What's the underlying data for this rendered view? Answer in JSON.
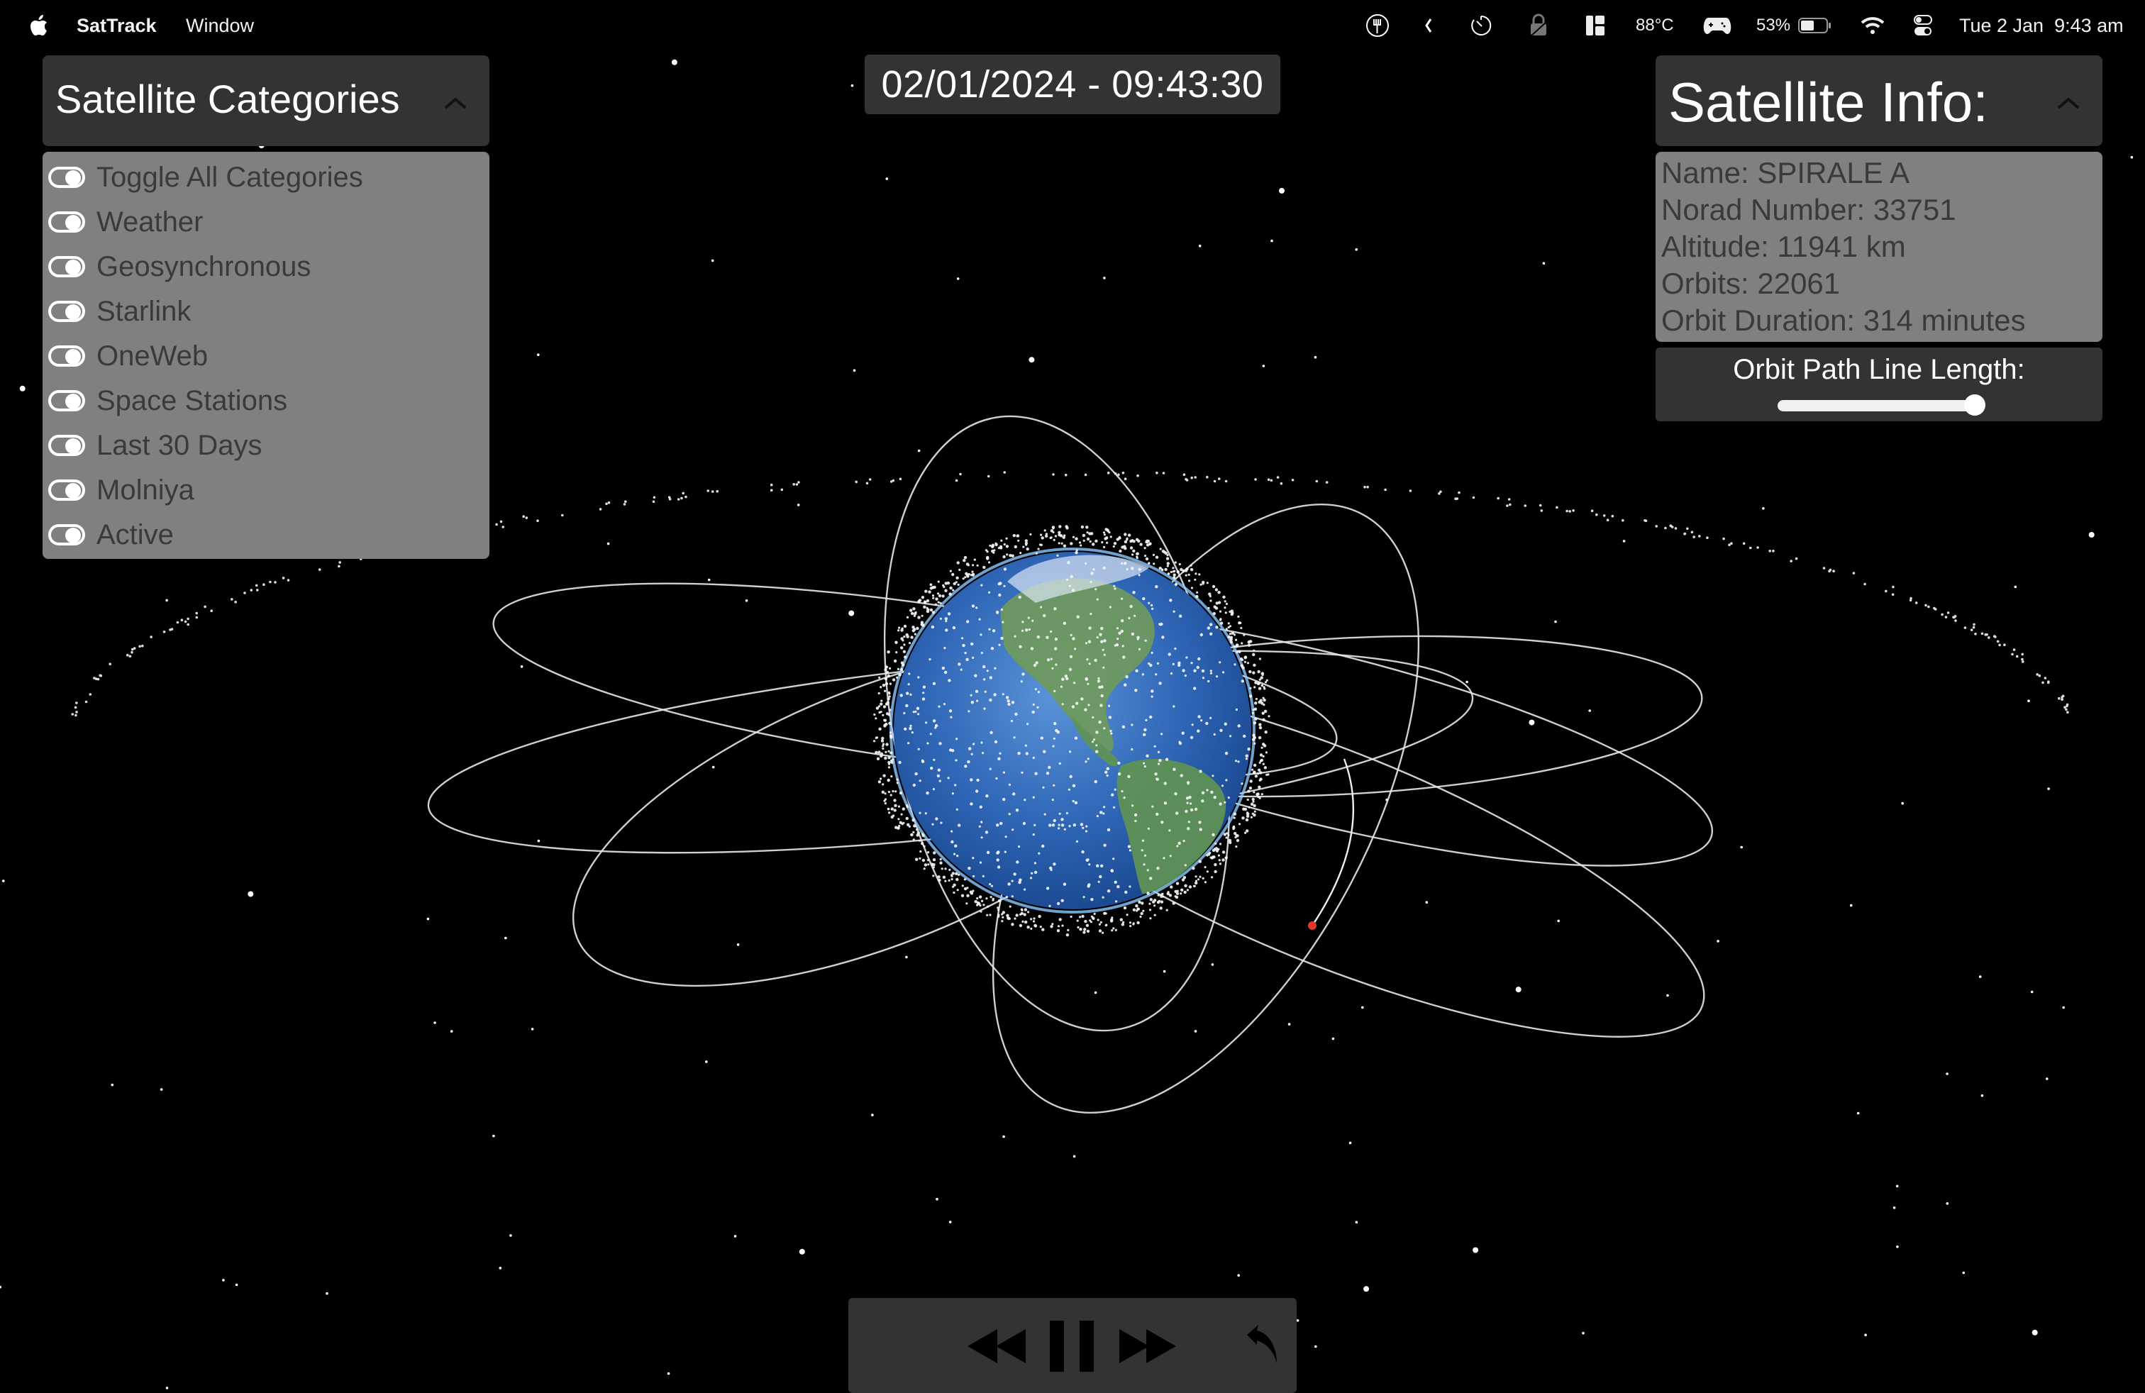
{
  "menubar": {
    "app_name": "SatTrack",
    "menus": [
      "Window"
    ],
    "status": {
      "icons": [
        "fork-icon",
        "chevron-left-icon",
        "timer-icon",
        "lock-disabled-icon",
        "layout-icon",
        "gamepad-icon",
        "battery-icon",
        "wifi-icon",
        "control-center-icon"
      ],
      "temperature": "88°C",
      "battery": "53%",
      "battery_level": 0.53,
      "datetime": "Tue 2 Jan  9:43 am"
    }
  },
  "categories_panel": {
    "title": "Satellite Categories",
    "collapse_icon": "chevron-up-icon",
    "items": [
      {
        "label": "Toggle All Categories",
        "on": true
      },
      {
        "label": "Weather",
        "on": true
      },
      {
        "label": "Geosynchronous",
        "on": true
      },
      {
        "label": "Starlink",
        "on": true
      },
      {
        "label": "OneWeb",
        "on": true
      },
      {
        "label": "Space Stations",
        "on": true
      },
      {
        "label": "Last 30 Days",
        "on": true
      },
      {
        "label": "Molniya",
        "on": true
      },
      {
        "label": "Active",
        "on": true
      }
    ]
  },
  "sim_time": "02/01/2024 - 09:43:30",
  "info_panel": {
    "title": "Satellite Info:",
    "collapse_icon": "chevron-up-icon",
    "lines": [
      "Name: SPIRALE A",
      "Norad Number: 33751",
      "Altitude: 11941 km",
      "Orbits: 22061",
      "Orbit Duration: 314 minutes"
    ],
    "satellite": {
      "name": "SPIRALE A",
      "norad_number": "33751",
      "altitude_km": 11941,
      "orbits": 22061,
      "orbit_duration_min": 314
    },
    "slider": {
      "label": "Orbit Path Line Length:",
      "value_fraction": 1.0
    }
  },
  "playback": {
    "buttons": [
      "rewind",
      "pause",
      "fast-forward",
      "reset"
    ]
  },
  "colors": {
    "panel_dark": "#333333",
    "panel_grey": "#808080",
    "selected_satellite": "#e0362c",
    "orbit_line": "#e6e6e6"
  }
}
